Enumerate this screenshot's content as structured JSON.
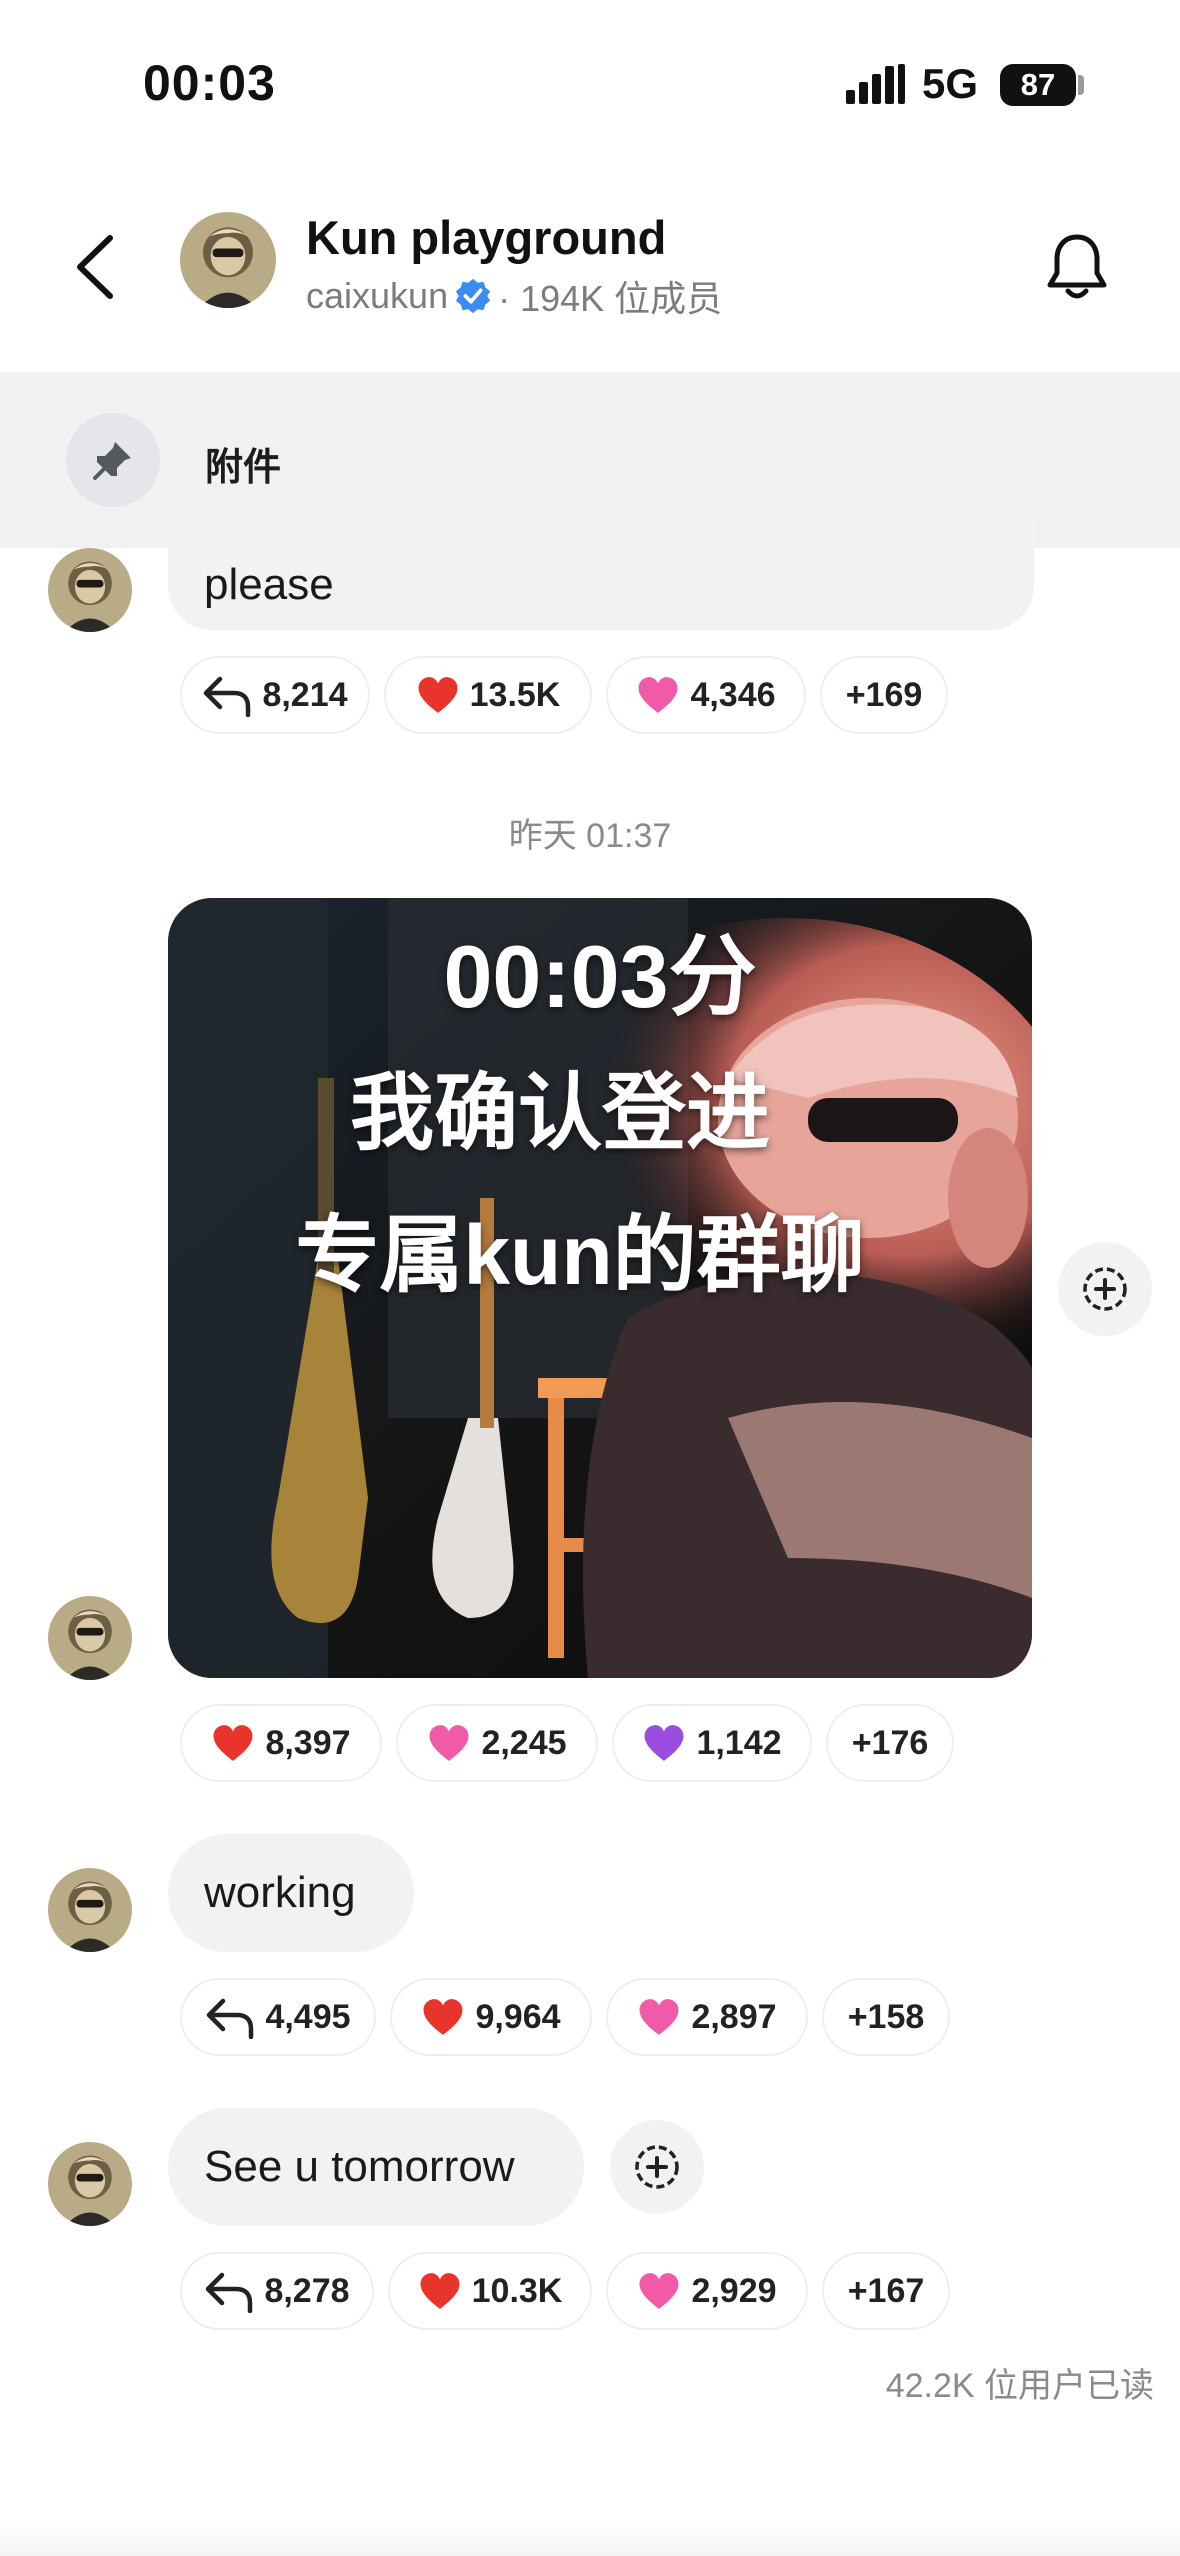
{
  "status_bar": {
    "time": "00:03",
    "network": "5G",
    "battery": "87"
  },
  "header": {
    "title": "Kun playground",
    "owner": "caixukun",
    "members": "· 194K 位成员"
  },
  "pinned": {
    "label": "附件"
  },
  "messages": [
    {
      "text": "please",
      "reactions": [
        {
          "icon": "reply-icon",
          "count": "8,214"
        },
        {
          "icon": "red-heart-icon",
          "count": "13.5K"
        },
        {
          "icon": "pink-heart-icon",
          "count": "4,346"
        },
        {
          "icon": "",
          "count": "+169"
        }
      ]
    },
    {
      "type": "image",
      "overlay_lines": [
        "00:03分",
        "我确认登进",
        "专属kun的群聊"
      ],
      "reactions": [
        {
          "icon": "red-heart-icon",
          "count": "8,397"
        },
        {
          "icon": "pink-heart-icon",
          "count": "2,245"
        },
        {
          "icon": "purple-heart-icon",
          "count": "1,142"
        },
        {
          "icon": "",
          "count": "+176"
        }
      ]
    },
    {
      "text": "working",
      "reactions": [
        {
          "icon": "reply-icon",
          "count": "4,495"
        },
        {
          "icon": "red-heart-icon",
          "count": "9,964"
        },
        {
          "icon": "pink-heart-icon",
          "count": "2,897"
        },
        {
          "icon": "",
          "count": "+158"
        }
      ]
    },
    {
      "text": "See u tomorrow",
      "reactions": [
        {
          "icon": "reply-icon",
          "count": "8,278"
        },
        {
          "icon": "red-heart-icon",
          "count": "10.3K"
        },
        {
          "icon": "pink-heart-icon",
          "count": "2,929"
        },
        {
          "icon": "",
          "count": "+167"
        }
      ]
    }
  ],
  "timestamp": "昨天 01:37",
  "read_count": "42.2K 位用户已读",
  "colors": {
    "verified": "#3b8cf0",
    "red_heart": "#e8342b",
    "pink_heart": "#f05aa6",
    "purple_heart": "#9b4de0"
  }
}
